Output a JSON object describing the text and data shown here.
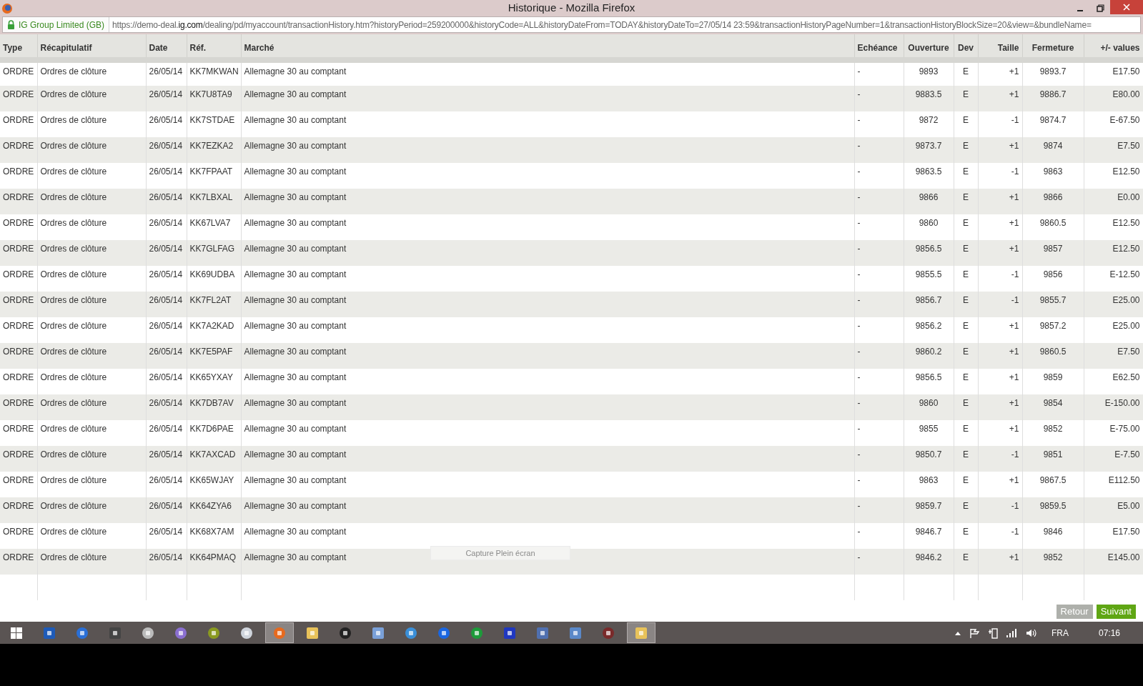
{
  "window": {
    "title": "Historique - Mozilla Firefox"
  },
  "address_bar": {
    "identity": "IG Group Limited (GB)",
    "url_prefix": "https://demo-deal.",
    "url_domain": "ig.com",
    "url_rest": "/dealing/pd/myaccount/transactionHistory.htm?historyPeriod=259200000&historyCode=ALL&historyDateFrom=TODAY&historyDateTo=27/05/14 23:59&transactionHistoryPageNumber=1&transactionHistoryBlockSize=20&view=&bundleName="
  },
  "table": {
    "columns": [
      "Type",
      "Récapitulatif",
      "Date",
      "Réf.",
      "Marché",
      "Echéance",
      "Ouverture",
      "Dev",
      "Taille",
      "Fermeture",
      "+/- values"
    ],
    "rows": [
      [
        "ORDRE",
        "Ordres de clôture",
        "26/05/14",
        "KK7MKWAN",
        "Allemagne 30 au comptant",
        "-",
        "9893",
        "E",
        "+1",
        "9893.7",
        "E17.50"
      ],
      [
        "ORDRE",
        "Ordres de clôture",
        "26/05/14",
        "KK7U8TA9",
        "Allemagne 30 au comptant",
        "-",
        "9883.5",
        "E",
        "+1",
        "9886.7",
        "E80.00"
      ],
      [
        "ORDRE",
        "Ordres de clôture",
        "26/05/14",
        "KK7STDAE",
        "Allemagne 30 au comptant",
        "-",
        "9872",
        "E",
        "-1",
        "9874.7",
        "E-67.50"
      ],
      [
        "ORDRE",
        "Ordres de clôture",
        "26/05/14",
        "KK7EZKA2",
        "Allemagne 30 au comptant",
        "-",
        "9873.7",
        "E",
        "+1",
        "9874",
        "E7.50"
      ],
      [
        "ORDRE",
        "Ordres de clôture",
        "26/05/14",
        "KK7FPAAT",
        "Allemagne 30 au comptant",
        "-",
        "9863.5",
        "E",
        "-1",
        "9863",
        "E12.50"
      ],
      [
        "ORDRE",
        "Ordres de clôture",
        "26/05/14",
        "KK7LBXAL",
        "Allemagne 30 au comptant",
        "-",
        "9866",
        "E",
        "+1",
        "9866",
        "E0.00"
      ],
      [
        "ORDRE",
        "Ordres de clôture",
        "26/05/14",
        "KK67LVA7",
        "Allemagne 30 au comptant",
        "-",
        "9860",
        "E",
        "+1",
        "9860.5",
        "E12.50"
      ],
      [
        "ORDRE",
        "Ordres de clôture",
        "26/05/14",
        "KK7GLFAG",
        "Allemagne 30 au comptant",
        "-",
        "9856.5",
        "E",
        "+1",
        "9857",
        "E12.50"
      ],
      [
        "ORDRE",
        "Ordres de clôture",
        "26/05/14",
        "KK69UDBA",
        "Allemagne 30 au comptant",
        "-",
        "9855.5",
        "E",
        "-1",
        "9856",
        "E-12.50"
      ],
      [
        "ORDRE",
        "Ordres de clôture",
        "26/05/14",
        "KK7FL2AT",
        "Allemagne 30 au comptant",
        "-",
        "9856.7",
        "E",
        "-1",
        "9855.7",
        "E25.00"
      ],
      [
        "ORDRE",
        "Ordres de clôture",
        "26/05/14",
        "KK7A2KAD",
        "Allemagne 30 au comptant",
        "-",
        "9856.2",
        "E",
        "+1",
        "9857.2",
        "E25.00"
      ],
      [
        "ORDRE",
        "Ordres de clôture",
        "26/05/14",
        "KK7E5PAF",
        "Allemagne 30 au comptant",
        "-",
        "9860.2",
        "E",
        "+1",
        "9860.5",
        "E7.50"
      ],
      [
        "ORDRE",
        "Ordres de clôture",
        "26/05/14",
        "KK65YXAY",
        "Allemagne 30 au comptant",
        "-",
        "9856.5",
        "E",
        "+1",
        "9859",
        "E62.50"
      ],
      [
        "ORDRE",
        "Ordres de clôture",
        "26/05/14",
        "KK7DB7AV",
        "Allemagne 30 au comptant",
        "-",
        "9860",
        "E",
        "+1",
        "9854",
        "E-150.00"
      ],
      [
        "ORDRE",
        "Ordres de clôture",
        "26/05/14",
        "KK7D6PAE",
        "Allemagne 30 au comptant",
        "-",
        "9855",
        "E",
        "+1",
        "9852",
        "E-75.00"
      ],
      [
        "ORDRE",
        "Ordres de clôture",
        "26/05/14",
        "KK7AXCAD",
        "Allemagne 30 au comptant",
        "-",
        "9850.7",
        "E",
        "-1",
        "9851",
        "E-7.50"
      ],
      [
        "ORDRE",
        "Ordres de clôture",
        "26/05/14",
        "KK65WJAY",
        "Allemagne 30 au comptant",
        "-",
        "9863",
        "E",
        "+1",
        "9867.5",
        "E112.50"
      ],
      [
        "ORDRE",
        "Ordres de clôture",
        "26/05/14",
        "KK64ZYA6",
        "Allemagne 30 au comptant",
        "-",
        "9859.7",
        "E",
        "-1",
        "9859.5",
        "E5.00"
      ],
      [
        "ORDRE",
        "Ordres de clôture",
        "26/05/14",
        "KK68X7AM",
        "Allemagne 30 au comptant",
        "-",
        "9846.7",
        "E",
        "-1",
        "9846",
        "E17.50"
      ],
      [
        "ORDRE",
        "Ordres de clôture",
        "26/05/14",
        "KK64PMAQ",
        "Allemagne 30 au comptant",
        "-",
        "9846.2",
        "E",
        "+1",
        "9852",
        "E145.00"
      ]
    ]
  },
  "tooltip": "Capture Plein écran",
  "buttons": [
    {
      "label": "Retour",
      "disabled": true
    },
    {
      "label": "Suivant",
      "disabled": false
    }
  ],
  "taskbar": {
    "items": [
      {
        "selected": false
      },
      {
        "selected": false
      },
      {
        "selected": false
      },
      {
        "selected": false
      },
      {
        "selected": false
      },
      {
        "selected": false
      },
      {
        "selected": false
      },
      {
        "selected": false
      },
      {
        "selected": true
      },
      {
        "selected": false
      },
      {
        "selected": false
      },
      {
        "selected": false
      },
      {
        "selected": false
      },
      {
        "selected": false
      },
      {
        "selected": false
      },
      {
        "selected": false
      },
      {
        "selected": false
      },
      {
        "selected": false
      },
      {
        "selected": false
      },
      {
        "selected": true
      }
    ],
    "language": "FRA",
    "time": "07:16"
  }
}
